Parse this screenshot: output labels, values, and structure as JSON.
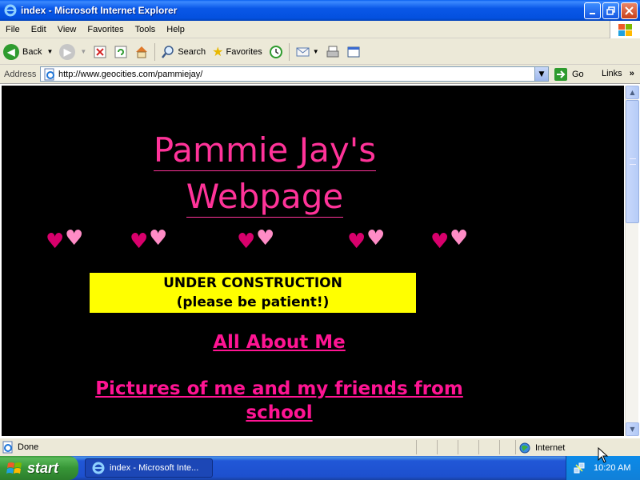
{
  "window": {
    "title": "index - Microsoft Internet Explorer"
  },
  "menu": [
    "File",
    "Edit",
    "View",
    "Favorites",
    "Tools",
    "Help"
  ],
  "toolbar": {
    "back": "Back",
    "search": "Search",
    "favorites": "Favorites"
  },
  "address": {
    "label": "Address",
    "url": "http://www.geocities.com/pammiejay/",
    "go": "Go",
    "links": "Links"
  },
  "page": {
    "title_line1": "Pammie Jay's",
    "title_line2": "Webpage",
    "construction_line1": "UNDER CONSTRUCTION",
    "construction_line2": "(please be patient!)",
    "link_about": "All About Me",
    "link_pictures_line1": "Pictures of me and my friends from",
    "link_pictures_line2": "school",
    "colors": {
      "background": "#000000",
      "title": "#FF3399",
      "link": "#FF1493",
      "banner": "#FFFF00"
    }
  },
  "status": {
    "text": "Done",
    "zone": "Internet"
  },
  "taskbar": {
    "start": "start",
    "task": "index - Microsoft Inte...",
    "clock": "10:20 AM"
  }
}
